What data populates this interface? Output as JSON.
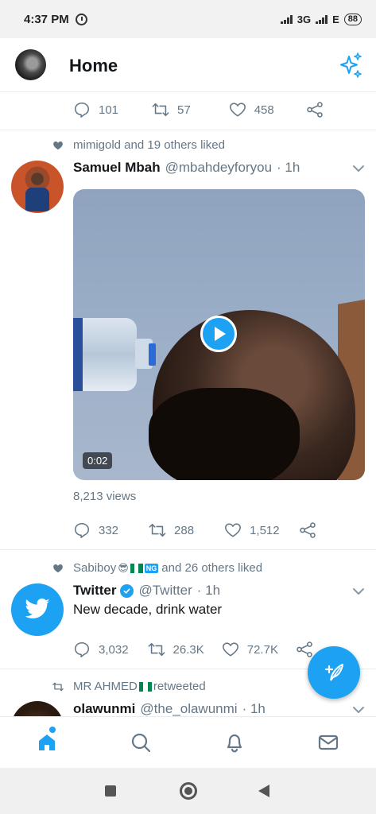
{
  "status_bar": {
    "time": "4:37 PM",
    "network": "3G",
    "network2": "E",
    "battery": "88"
  },
  "header": {
    "title": "Home"
  },
  "top_tweet": {
    "replies": "101",
    "retweets": "57",
    "likes": "458"
  },
  "tweet1": {
    "social_context": "mimigold and 19 others liked",
    "name": "Samuel Mbah",
    "handle": "@mbahdeyforyou",
    "time": "· 1h",
    "video_duration": "0:02",
    "views": "8,213 views",
    "replies": "332",
    "retweets": "288",
    "likes": "1,512"
  },
  "tweet2": {
    "social_context_user": "Sabiboy",
    "social_badge": "NG",
    "social_context_rest": "and 26 others liked",
    "name": "Twitter",
    "handle": "@Twitter",
    "time": "· 1h",
    "text": "New decade, drink water",
    "replies": "3,032",
    "retweets": "26.3K",
    "likes": "72.7K"
  },
  "tweet3": {
    "social_context": "MR AHMED",
    "social_context_rest": "retweeted",
    "name": "olawunmi",
    "handle": "@the_olawunmi",
    "time": "· 1h"
  },
  "colors": {
    "accent": "#1da1f2",
    "text_secondary": "#657786",
    "nigeria_green": "#008751"
  },
  "icons": {
    "header": "sparkle-icon",
    "tabs": [
      "home-icon",
      "search-icon",
      "notifications-icon",
      "messages-icon"
    ],
    "fab": "compose-tweet-icon"
  }
}
